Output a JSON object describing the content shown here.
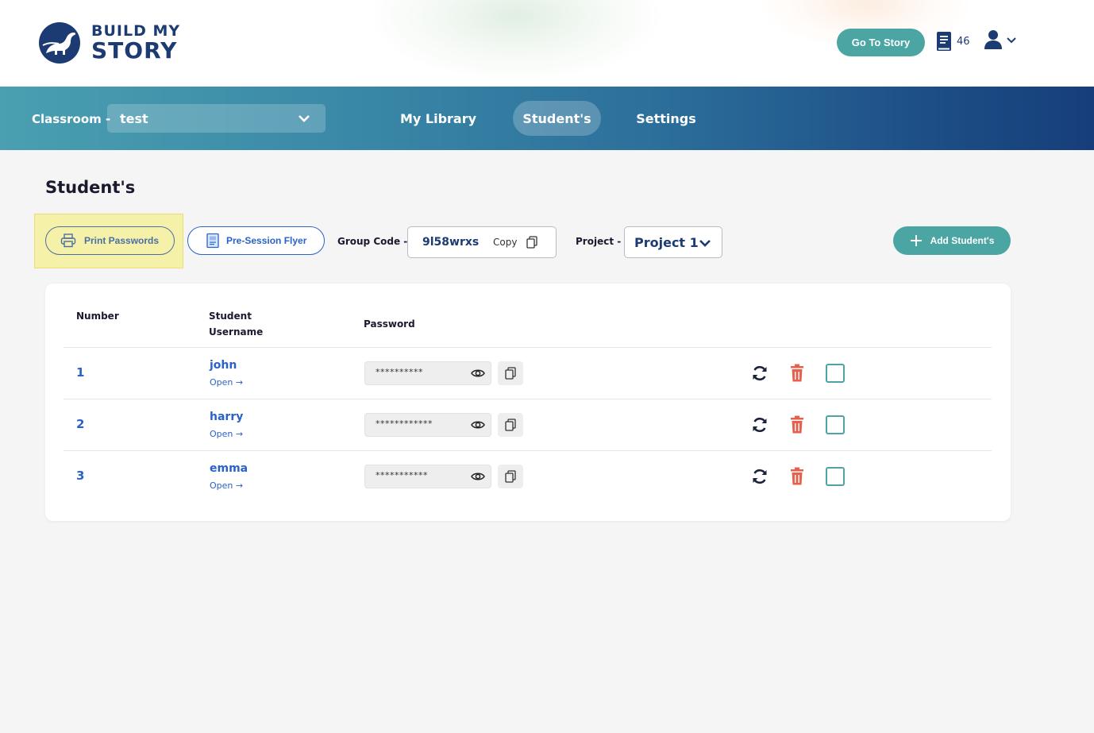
{
  "brand": {
    "line1": "BUILD MY",
    "line2": "STORY"
  },
  "header": {
    "goto_label": "Go To Story",
    "books_count": "46"
  },
  "nav": {
    "classroom_label": "Classroom -",
    "classroom_value": "test",
    "items": [
      {
        "label": "My Library"
      },
      {
        "label": "Student's",
        "active": true
      },
      {
        "label": "Settings"
      }
    ]
  },
  "page": {
    "title": "Student's"
  },
  "toolbar": {
    "print_label": "Print Passwords",
    "flyer_label": "Pre-Session Flyer",
    "group_code_label": "Group Code -",
    "group_code": "9l58wrxs",
    "copy_label": "Copy",
    "project_label": "Project -",
    "project_value": "Project 1",
    "add_label": "Add Student's"
  },
  "table": {
    "headers": {
      "number": "Number",
      "username": "Student Username",
      "password": "Password"
    },
    "rows": [
      {
        "number": "1",
        "username": "john",
        "open": "Open →",
        "password_mask": "**********"
      },
      {
        "number": "2",
        "username": "harry",
        "open": "Open →",
        "password_mask": "************"
      },
      {
        "number": "3",
        "username": "emma",
        "open": "Open →",
        "password_mask": "***********"
      }
    ]
  },
  "colors": {
    "accent": "#4aa5a3",
    "brand": "#1d3b73",
    "link": "#2a62c9",
    "danger": "#e8604c"
  },
  "icons": [
    "dinosaur-logo-icon",
    "book-icon",
    "user-icon",
    "chevron-down-icon",
    "printer-icon",
    "flyer-icon",
    "copy-icon",
    "plus-icon",
    "eye-icon",
    "refresh-icon",
    "trash-icon",
    "checkbox-icon"
  ]
}
